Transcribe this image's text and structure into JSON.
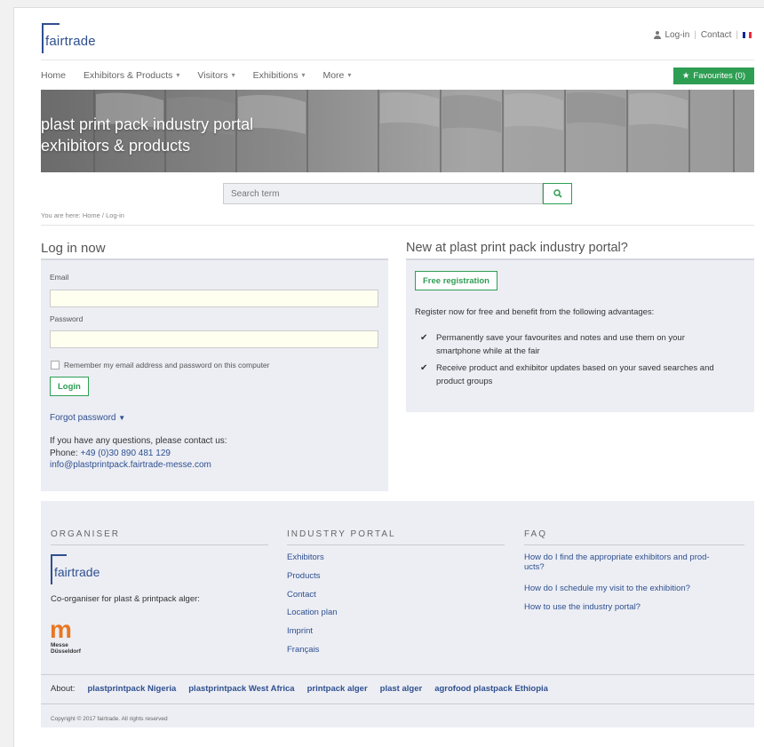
{
  "header": {
    "logo_text": "fairtrade",
    "login": "Log-in",
    "contact": "Contact",
    "separator": "|",
    "flag_colors": [
      "#002395",
      "#ffffff",
      "#ed2939"
    ]
  },
  "nav": {
    "items": [
      "Home",
      "Exhibitors & Products",
      "Visitors",
      "Exhibitions",
      "More"
    ],
    "favourites": "Favourites (0)"
  },
  "hero": {
    "line1": "plast print pack industry portal",
    "line2": "exhibitors & products"
  },
  "search": {
    "placeholder": "Search term"
  },
  "breadcrumb": "You are here:  Home  /  Log-in",
  "login": {
    "heading": "Log in now",
    "email_label": "Email",
    "email_value": "",
    "password_label": "Password",
    "password_value": "",
    "remember": "Remember my email address and password on this computer",
    "button": "Login",
    "forgot": "Forgot password",
    "contact_line": "If you have any questions, please contact us:",
    "phone_label": "Phone:",
    "phone": "+49 (0)30 890 481 129",
    "email": "info@plastprintpack.fairtrade-messe.com"
  },
  "register": {
    "heading": "New at plast print pack industry portal?",
    "button": "Free registration",
    "intro": "Register now for free and benefit from the following advantages:",
    "advantages": [
      "Permanently save your favourites and notes and use them on your smartphone while at the fair",
      "Receive product and exhibitor updates based on your saved searches and product groups"
    ]
  },
  "footer": {
    "organiser_heading": "ORGANISER",
    "organiser_logo": "fairtrade",
    "coorganiser": "Co-organiser for plast & printpack alger:",
    "messe_m": "m",
    "messe_text_1": "Messe",
    "messe_text_2": "Düsseldorf",
    "portal_heading": "INDUSTRY PORTAL",
    "portal_links": [
      "Exhibitors",
      "Products",
      "Contact",
      "Location plan",
      "Imprint",
      "Français"
    ],
    "faq_heading": "FAQ",
    "faq_links": [
      "How do I find the appropriate exhibitors and prod-",
      "ucts?",
      "How do I schedule my visit to the exhibition?",
      "How to use the industry portal?"
    ],
    "about_label": "About:",
    "about_links": [
      "plastprintpack Nigeria",
      "plastprintpack West Africa",
      "printpack alger",
      "plast alger",
      "agrofood plastpack Ethiopia"
    ],
    "copyright": "Copyright © 2017 fairtrade. All rights reserved"
  },
  "colors": {
    "brand_blue": "#2f4f8f",
    "brand_green": "#2e9e53"
  }
}
